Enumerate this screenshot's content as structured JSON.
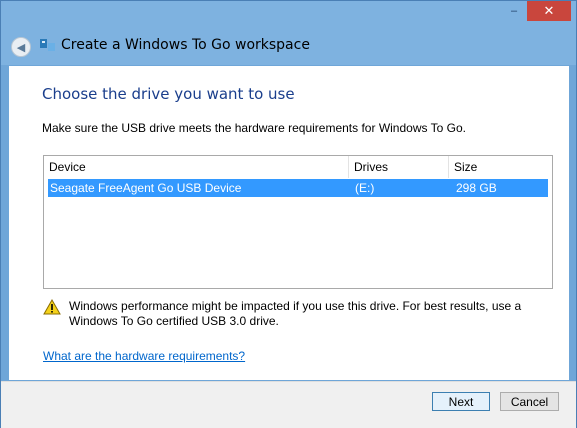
{
  "window": {
    "title": "Create a Windows To Go workspace",
    "controls": {
      "minimize": "–",
      "close": "✕"
    }
  },
  "heading": "Choose the drive you want to use",
  "instructions": "Make sure the USB drive meets the hardware requirements for Windows To Go.",
  "table": {
    "columns": [
      "Device",
      "Drives",
      "Size"
    ],
    "rows": [
      {
        "device": "Seagate FreeAgent Go USB Device",
        "drive": "(E:)",
        "size": "298 GB",
        "selected": true
      }
    ]
  },
  "warning": "Windows performance might be impacted if you use this drive. For best results, use a Windows To Go certified USB 3.0 drive.",
  "link": "What are the hardware requirements?",
  "buttons": {
    "next": "Next",
    "cancel": "Cancel"
  },
  "colors": {
    "selection": "#3399ff",
    "heading": "#1a3e8c",
    "link": "#0066cc",
    "close_button": "#c9463d"
  }
}
